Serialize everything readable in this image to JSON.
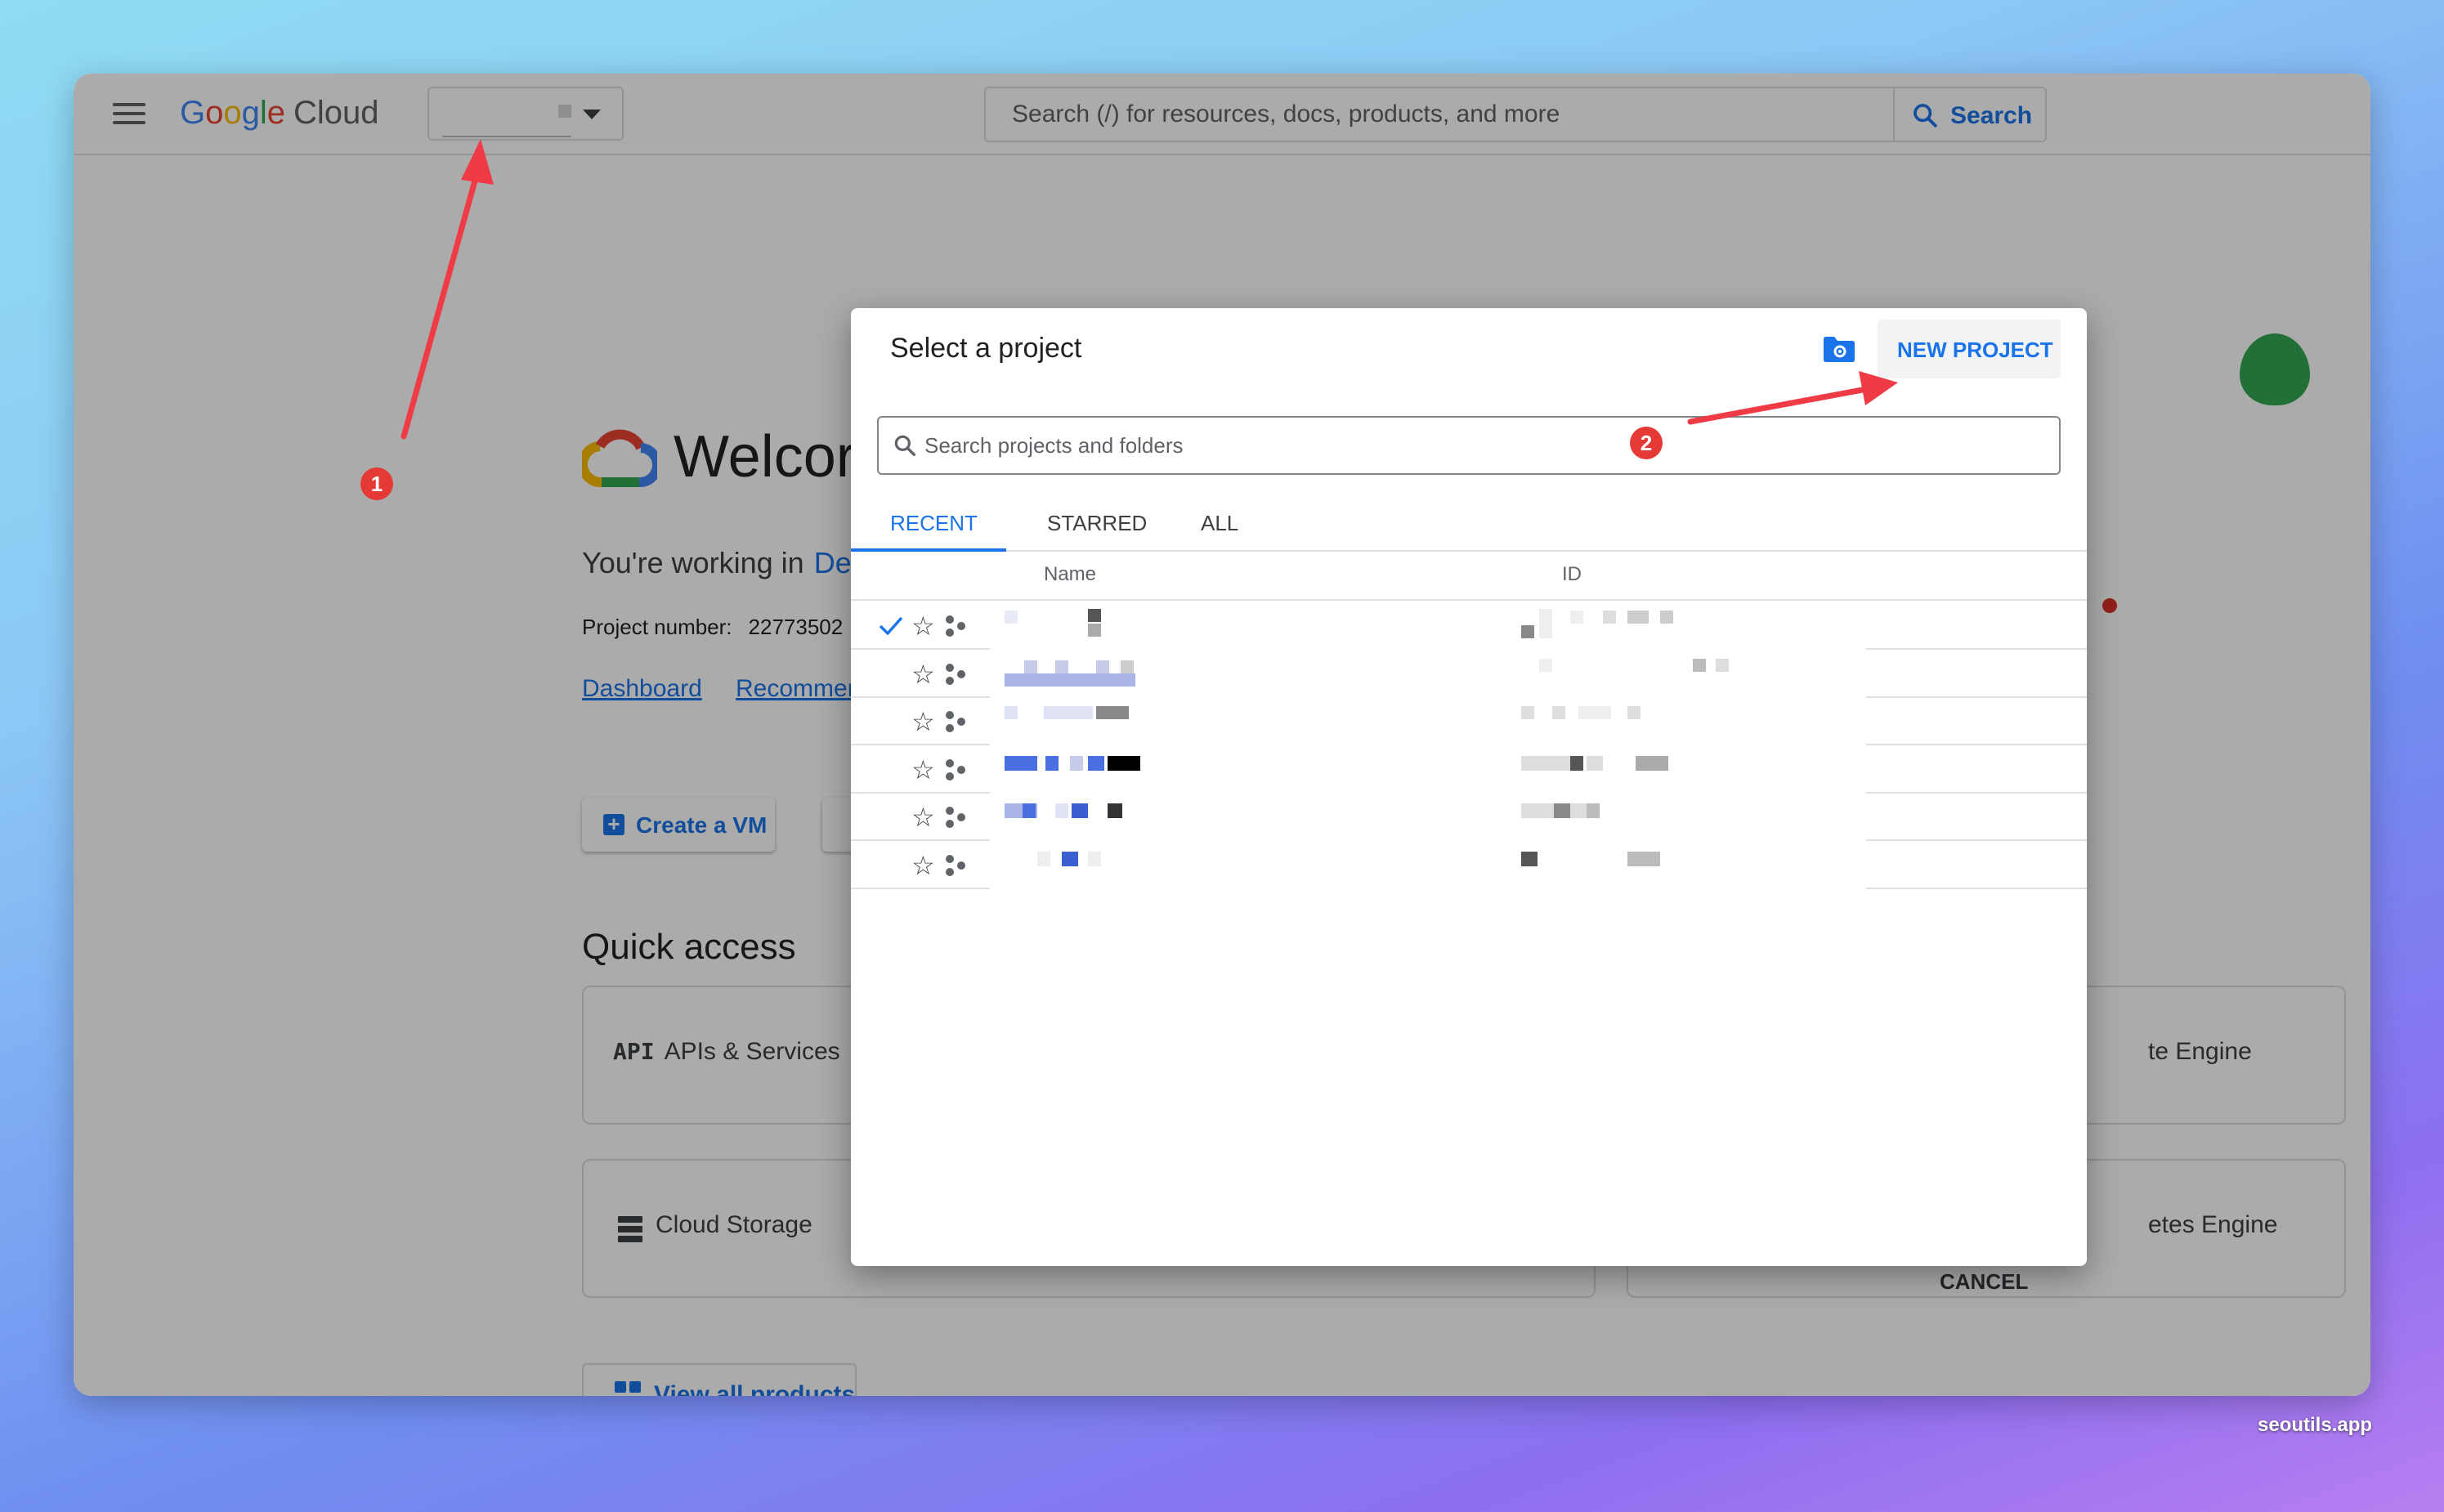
{
  "header": {
    "logo_google": "Google",
    "logo_cloud": "Cloud",
    "search_placeholder": "Search (/) for resources, docs, products, and more",
    "search_button": "Search"
  },
  "welcome": {
    "heading": "Welcor",
    "working_in": "You're working in",
    "project_name": "De",
    "project_number_label": "Project number:",
    "project_number_value": "22773502",
    "link_dashboard": "Dashboard",
    "link_recommendations": "Recommen",
    "create_vm": "Create a VM",
    "quick_access": "Quick access",
    "cards": [
      {
        "glyph": "API",
        "label": "APIs & Services"
      },
      {
        "label": "Cloud Storage"
      },
      {
        "label": "te Engine"
      },
      {
        "label": "etes Engine"
      }
    ],
    "view_all": "View all products"
  },
  "dialog": {
    "title": "Select a project",
    "new_project": "NEW PROJECT",
    "search_placeholder": "Search projects and folders",
    "tabs": [
      {
        "label": "RECENT",
        "active": true
      },
      {
        "label": "STARRED",
        "active": false
      },
      {
        "label": "ALL",
        "active": false
      }
    ],
    "columns": {
      "name": "Name",
      "id": "ID"
    },
    "rows": [
      {
        "selected": true
      },
      {
        "selected": false
      },
      {
        "selected": false
      },
      {
        "selected": false
      },
      {
        "selected": false
      },
      {
        "selected": false
      }
    ],
    "cancel": "CANCEL"
  },
  "annotations": {
    "badge1": "1",
    "badge2": "2",
    "arrow_color": "#ef3b45"
  },
  "colors": {
    "accent": "#1a73e8",
    "overlay": "rgba(0,0,0,0.33)"
  },
  "watermark": "seoutils.app"
}
